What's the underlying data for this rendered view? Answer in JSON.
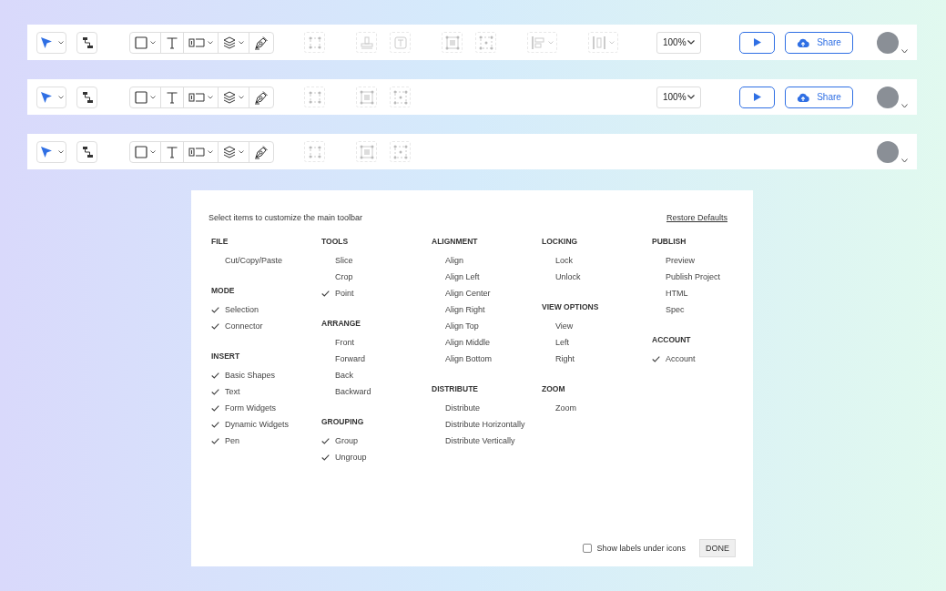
{
  "toolbars": [
    {
      "ghost_groups": [
        [
          {
            "kind": "points"
          }
        ],
        [
          {
            "kind": "stamp"
          },
          {
            "kind": "text-style"
          }
        ],
        [
          {
            "kind": "group"
          },
          {
            "kind": "ungroup"
          }
        ],
        [
          {
            "kind": "align-dropdown"
          }
        ],
        [
          {
            "kind": "distribute-dropdown"
          }
        ]
      ],
      "zoom": {
        "value": "100%"
      },
      "play": {
        "kind": "play"
      },
      "share": {
        "label": "Share"
      }
    },
    {
      "ghost_groups": [
        [
          {
            "kind": "points"
          }
        ],
        [
          {
            "kind": "group"
          },
          {
            "kind": "ungroup"
          }
        ]
      ],
      "zoom": {
        "value": "100%"
      },
      "play": {
        "kind": "play"
      },
      "share": {
        "label": "Share"
      }
    },
    {
      "ghost_groups": [
        [
          {
            "kind": "points"
          }
        ],
        [
          {
            "kind": "group"
          },
          {
            "kind": "ungroup"
          }
        ]
      ]
    }
  ],
  "dialog": {
    "instruction": "Select items to customize the main toolbar",
    "restore_link": "Restore Defaults",
    "columns": [
      [
        {
          "title": "FILE",
          "items": [
            {
              "label": "Cut/Copy/Paste",
              "checked": false
            }
          ]
        },
        {
          "title": "MODE",
          "items": [
            {
              "label": "Selection",
              "checked": true
            },
            {
              "label": "Connector",
              "checked": true
            }
          ]
        },
        {
          "title": "INSERT",
          "items": [
            {
              "label": "Basic Shapes",
              "checked": true
            },
            {
              "label": "Text",
              "checked": true
            },
            {
              "label": "Form Widgets",
              "checked": true
            },
            {
              "label": "Dynamic Widgets",
              "checked": true
            },
            {
              "label": "Pen",
              "checked": true
            }
          ]
        }
      ],
      [
        {
          "title": "TOOLS",
          "items": [
            {
              "label": "Slice",
              "checked": false
            },
            {
              "label": "Crop",
              "checked": false
            },
            {
              "label": "Point",
              "checked": true
            }
          ]
        },
        {
          "title": "ARRANGE",
          "items": [
            {
              "label": "Front",
              "checked": false
            },
            {
              "label": "Forward",
              "checked": false
            },
            {
              "label": "Back",
              "checked": false
            },
            {
              "label": "Backward",
              "checked": false
            }
          ]
        },
        {
          "title": "GROUPING",
          "items": [
            {
              "label": "Group",
              "checked": true
            },
            {
              "label": "Ungroup",
              "checked": true
            }
          ]
        }
      ],
      [
        {
          "title": "ALIGNMENT",
          "items": [
            {
              "label": "Align",
              "checked": false
            },
            {
              "label": "Align Left",
              "checked": false
            },
            {
              "label": "Align Center",
              "checked": false
            },
            {
              "label": "Align Right",
              "checked": false
            },
            {
              "label": "Align Top",
              "checked": false
            },
            {
              "label": "Align Middle",
              "checked": false
            },
            {
              "label": "Align Bottom",
              "checked": false
            }
          ]
        },
        {
          "title": "DISTRIBUTE",
          "items": [
            {
              "label": "Distribute",
              "checked": false
            },
            {
              "label": "Distribute Horizontally",
              "checked": false
            },
            {
              "label": "Distribute Vertically",
              "checked": false
            }
          ]
        }
      ],
      [
        {
          "title": "LOCKING",
          "items": [
            {
              "label": "Lock",
              "checked": false
            },
            {
              "label": "Unlock",
              "checked": false
            }
          ]
        },
        {
          "title": "VIEW OPTIONS",
          "items": [
            {
              "label": "View",
              "checked": false
            },
            {
              "label": "Left",
              "checked": false
            },
            {
              "label": "Right",
              "checked": false
            }
          ]
        },
        {
          "title": "ZOOM",
          "items": [
            {
              "label": "Zoom",
              "checked": false
            }
          ]
        }
      ],
      [
        {
          "title": "PUBLISH",
          "items": [
            {
              "label": "Preview",
              "checked": false
            },
            {
              "label": "Publish Project",
              "checked": false
            },
            {
              "label": "HTML",
              "checked": false
            },
            {
              "label": "Spec",
              "checked": false
            }
          ]
        },
        {
          "title": "ACCOUNT",
          "items": [
            {
              "label": "Account",
              "checked": true
            }
          ]
        }
      ]
    ],
    "labels_checkbox": {
      "label": "Show labels under icons",
      "checked": false
    },
    "done_button": "DONE"
  }
}
